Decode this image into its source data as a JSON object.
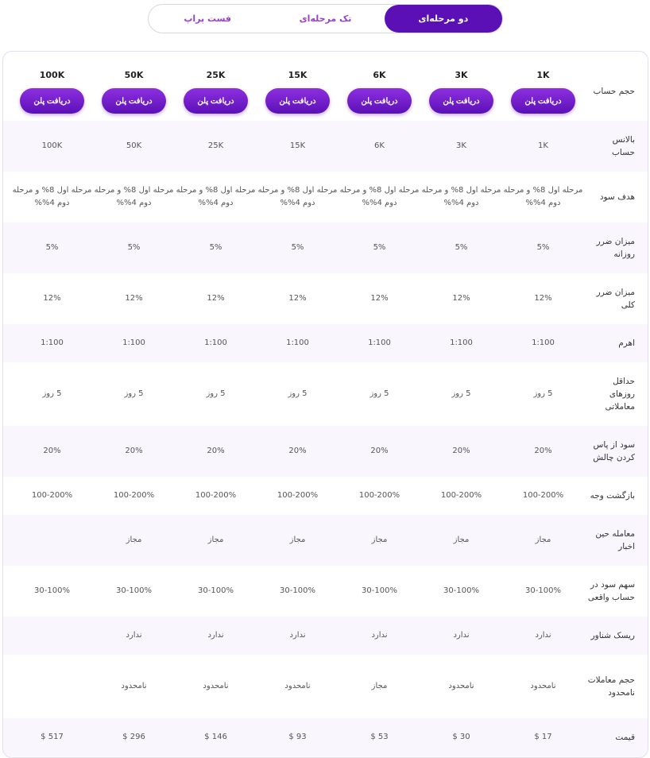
{
  "tabs": [
    {
      "label": "دو مرحله‌ای",
      "active": true
    },
    {
      "label": "تک مرحله‌ای",
      "active": false
    },
    {
      "label": "فست پراپ",
      "active": false
    }
  ],
  "table": {
    "header_label": "حجم حساب",
    "plans": [
      {
        "size": "1K",
        "button": "دریافت پلن"
      },
      {
        "size": "3K",
        "button": "دریافت پلن"
      },
      {
        "size": "6K",
        "button": "دریافت پلن"
      },
      {
        "size": "15K",
        "button": "دریافت پلن"
      },
      {
        "size": "25K",
        "button": "دریافت پلن"
      },
      {
        "size": "50K",
        "button": "دریافت پلن"
      },
      {
        "size": "100K",
        "button": "دریافت پلن"
      }
    ],
    "rows": [
      {
        "label": "بالانس حساب",
        "values": [
          "1K",
          "3K",
          "6K",
          "15K",
          "25K",
          "50K",
          "100K"
        ]
      },
      {
        "label": "هدف سود",
        "values": [
          "مرحله اول 8% و مرحله دوم 4%%",
          "مرحله اول 8% و مرحله دوم 4%%",
          "مرحله اول 8% و مرحله دوم 4%%",
          "مرحله اول 8% و مرحله دوم 4%%",
          "مرحله اول 8% و مرحله دوم 4%%",
          "مرحله اول 8% و مرحله دوم 4%%",
          "مرحله اول 8% و مرحله دوم 4%%"
        ]
      },
      {
        "label": "میزان ضرر روزانه",
        "values": [
          "5%",
          "5%",
          "5%",
          "5%",
          "5%",
          "5%",
          "5%"
        ]
      },
      {
        "label": "میزان ضرر کلی",
        "values": [
          "12%",
          "12%",
          "12%",
          "12%",
          "12%",
          "12%",
          "12%"
        ]
      },
      {
        "label": "اهرم",
        "values": [
          "1:100",
          "1:100",
          "1:100",
          "1:100",
          "1:100",
          "1:100",
          "1:100"
        ]
      },
      {
        "label": "حداقل روزهای معاملاتی",
        "values": [
          "5 روز",
          "5 روز",
          "5 روز",
          "5 روز",
          "5 روز",
          "5 روز",
          "5 روز"
        ]
      },
      {
        "label": "سود از پاس کردن چالش",
        "values": [
          "20%",
          "20%",
          "20%",
          "20%",
          "20%",
          "20%",
          "20%"
        ]
      },
      {
        "label": "بازگشت وجه",
        "values": [
          "100-200%",
          "100-200%",
          "100-200%",
          "100-200%",
          "100-200%",
          "100-200%",
          "100-200%"
        ]
      },
      {
        "label": "معامله حین اخبار",
        "values": [
          "مجاز",
          "مجاز",
          "مجاز",
          "مجاز",
          "مجاز",
          "مجاز",
          ""
        ]
      },
      {
        "label": "سهم سود در حساب واقعی",
        "values": [
          "30-100%",
          "30-100%",
          "30-100%",
          "30-100%",
          "30-100%",
          "30-100%",
          "30-100%"
        ]
      },
      {
        "label": "ریسک شناور",
        "values": [
          "ندارد",
          "ندارد",
          "ندارد",
          "ندارد",
          "ندارد",
          "ندارد",
          ""
        ]
      },
      {
        "label": "حجم معاملات نامحدود",
        "values": [
          "نامحدود",
          "نامحدود",
          "مجاز",
          "نامحدود",
          "نامحدود",
          "نامحدود",
          ""
        ]
      },
      {
        "label": "قیمت",
        "values": [
          "17 $",
          "30 $",
          "53 $",
          "93 $",
          "146 $",
          "296 $",
          "517 $"
        ]
      }
    ]
  }
}
